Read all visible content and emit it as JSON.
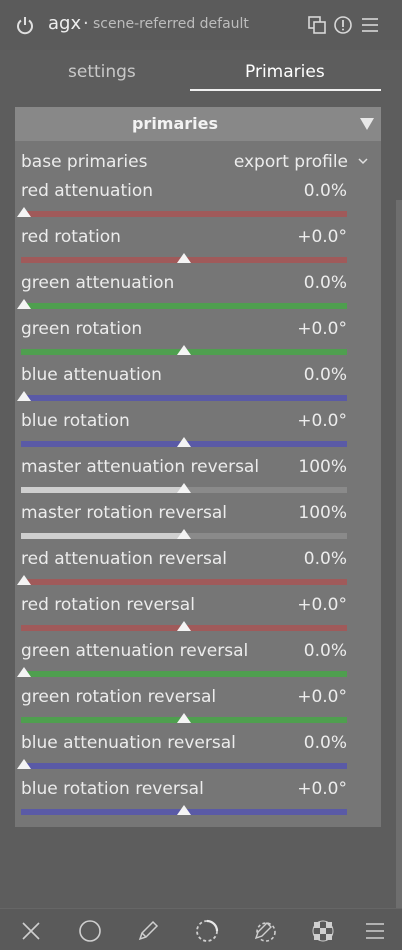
{
  "header": {
    "module_name": "agx",
    "separator": "·",
    "preset_name": "scene-referred default",
    "icons": [
      "power-icon",
      "multi-instance-icon",
      "reset-icon",
      "presets-menu-icon"
    ]
  },
  "tabs": [
    {
      "label": "settings",
      "active": false
    },
    {
      "label": "Primaries",
      "active": true
    }
  ],
  "section": {
    "title": "primaries",
    "collapse_icon": "triangle-down-icon"
  },
  "base_primaries": {
    "label": "base primaries",
    "value": "export profile"
  },
  "sliders": [
    {
      "label": "red attenuation",
      "value": "0.0%",
      "level": 0.0,
      "color": "#a05a5a",
      "type": "attenuation"
    },
    {
      "label": "red rotation",
      "value": "+0.0°",
      "level": 0.5,
      "color": "#a05a5a",
      "type": "rotation"
    },
    {
      "label": "green attenuation",
      "value": "0.0%",
      "level": 0.0,
      "color": "#4f9f4f",
      "type": "attenuation"
    },
    {
      "label": "green rotation",
      "value": "+0.0°",
      "level": 0.5,
      "color": "#4f9f4f",
      "type": "rotation"
    },
    {
      "label": "blue attenuation",
      "value": "0.0%",
      "level": 0.0,
      "color": "#5a5aa6",
      "type": "attenuation"
    },
    {
      "label": "blue rotation",
      "value": "+0.0°",
      "level": 0.5,
      "color": "#5a5aa6",
      "type": "rotation"
    },
    {
      "label": "master attenuation reversal",
      "value": "100%",
      "level": 0.5,
      "color": "#cfcfcf",
      "type": "master"
    },
    {
      "label": "master rotation reversal",
      "value": "100%",
      "level": 0.5,
      "color": "#cfcfcf",
      "type": "master"
    },
    {
      "label": "red attenuation reversal",
      "value": "0.0%",
      "level": 0.0,
      "color": "#a05a5a",
      "type": "attenuation"
    },
    {
      "label": "red rotation reversal",
      "value": "+0.0°",
      "level": 0.5,
      "color": "#a05a5a",
      "type": "rotation"
    },
    {
      "label": "green attenuation reversal",
      "value": "0.0%",
      "level": 0.0,
      "color": "#4f9f4f",
      "type": "attenuation"
    },
    {
      "label": "green rotation reversal",
      "value": "+0.0°",
      "level": 0.5,
      "color": "#4f9f4f",
      "type": "rotation"
    },
    {
      "label": "blue attenuation reversal",
      "value": "0.0%",
      "level": 0.0,
      "color": "#5a5aa6",
      "type": "attenuation"
    },
    {
      "label": "blue rotation reversal",
      "value": "+0.0°",
      "level": 0.5,
      "color": "#5a5aa6",
      "type": "rotation"
    }
  ],
  "bottom_bar": {
    "icons": [
      "close-icon",
      "circle-icon",
      "pencil-icon",
      "dotted-circle-icon",
      "pencil-circle-icon",
      "checkerboard-icon",
      "menu-icon"
    ]
  },
  "colors": {
    "master_track": "#8a8a8a",
    "master_fill": "#cfcfcf"
  }
}
